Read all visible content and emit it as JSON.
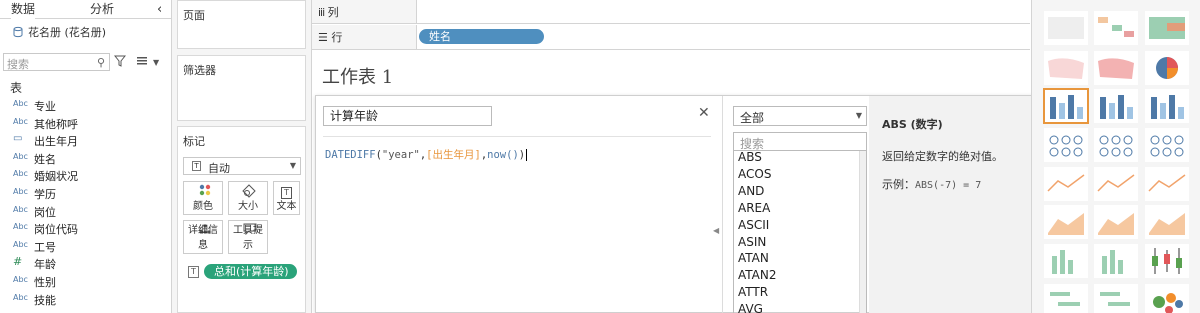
{
  "left_pane": {
    "tabs": [
      "数据",
      "分析"
    ],
    "datasource": "花名册 (花名册)",
    "search_placeholder": "搜索",
    "section_title": "表",
    "fields": [
      {
        "type": "Abc",
        "name": "专业"
      },
      {
        "type": "Abc",
        "name": "其他称呼"
      },
      {
        "type": "date",
        "name": "出生年月"
      },
      {
        "type": "Abc",
        "name": "姓名"
      },
      {
        "type": "Abc",
        "name": "婚姻状况"
      },
      {
        "type": "Abc",
        "name": "学历"
      },
      {
        "type": "Abc",
        "name": "岗位"
      },
      {
        "type": "Abc",
        "name": "岗位代码"
      },
      {
        "type": "Abc",
        "name": "工号"
      },
      {
        "type": "#",
        "name": "年龄"
      },
      {
        "type": "Abc",
        "name": "性别"
      },
      {
        "type": "Abc",
        "name": "技能"
      }
    ]
  },
  "cards": {
    "pages": "页面",
    "filters": "筛选器",
    "marks": "标记",
    "mark_type": "自动",
    "mark_buttons": [
      "颜色",
      "大小",
      "文本",
      "详细信息",
      "工具提示"
    ],
    "mark_pill": "总和(计算年龄)",
    "mark_pill_icon": "T"
  },
  "shelves": {
    "columns_label": "列",
    "rows_label": "行",
    "rows_pill": "姓名"
  },
  "worksheet": {
    "title": "工作表 1"
  },
  "calc_editor": {
    "name": "计算年龄",
    "formula": {
      "fn": "DATEDIFF",
      "open": "(",
      "arg1": "\"year\"",
      "comma1": ",",
      "arg2": "[出生年月]",
      "comma2": ",",
      "arg3": "now()",
      "close": ")"
    },
    "function_filter": "全部",
    "function_search_placeholder": "搜索",
    "functions": [
      "ABS",
      "ACOS",
      "AND",
      "AREA",
      "ASCII",
      "ASIN",
      "ATAN",
      "ATAN2",
      "ATTR",
      "AVG"
    ],
    "help_title": "ABS (数字)",
    "help_desc": "返回给定数字的绝对值。",
    "help_example_label": "示例：",
    "help_example_code": "ABS(-7) = 7"
  },
  "colors": {
    "pill_blue": "#4f8fbf",
    "pill_green": "#2aa37a",
    "formula_fn": "#4e79a7",
    "formula_field": "#e8963c",
    "formula_string": "#555555"
  }
}
